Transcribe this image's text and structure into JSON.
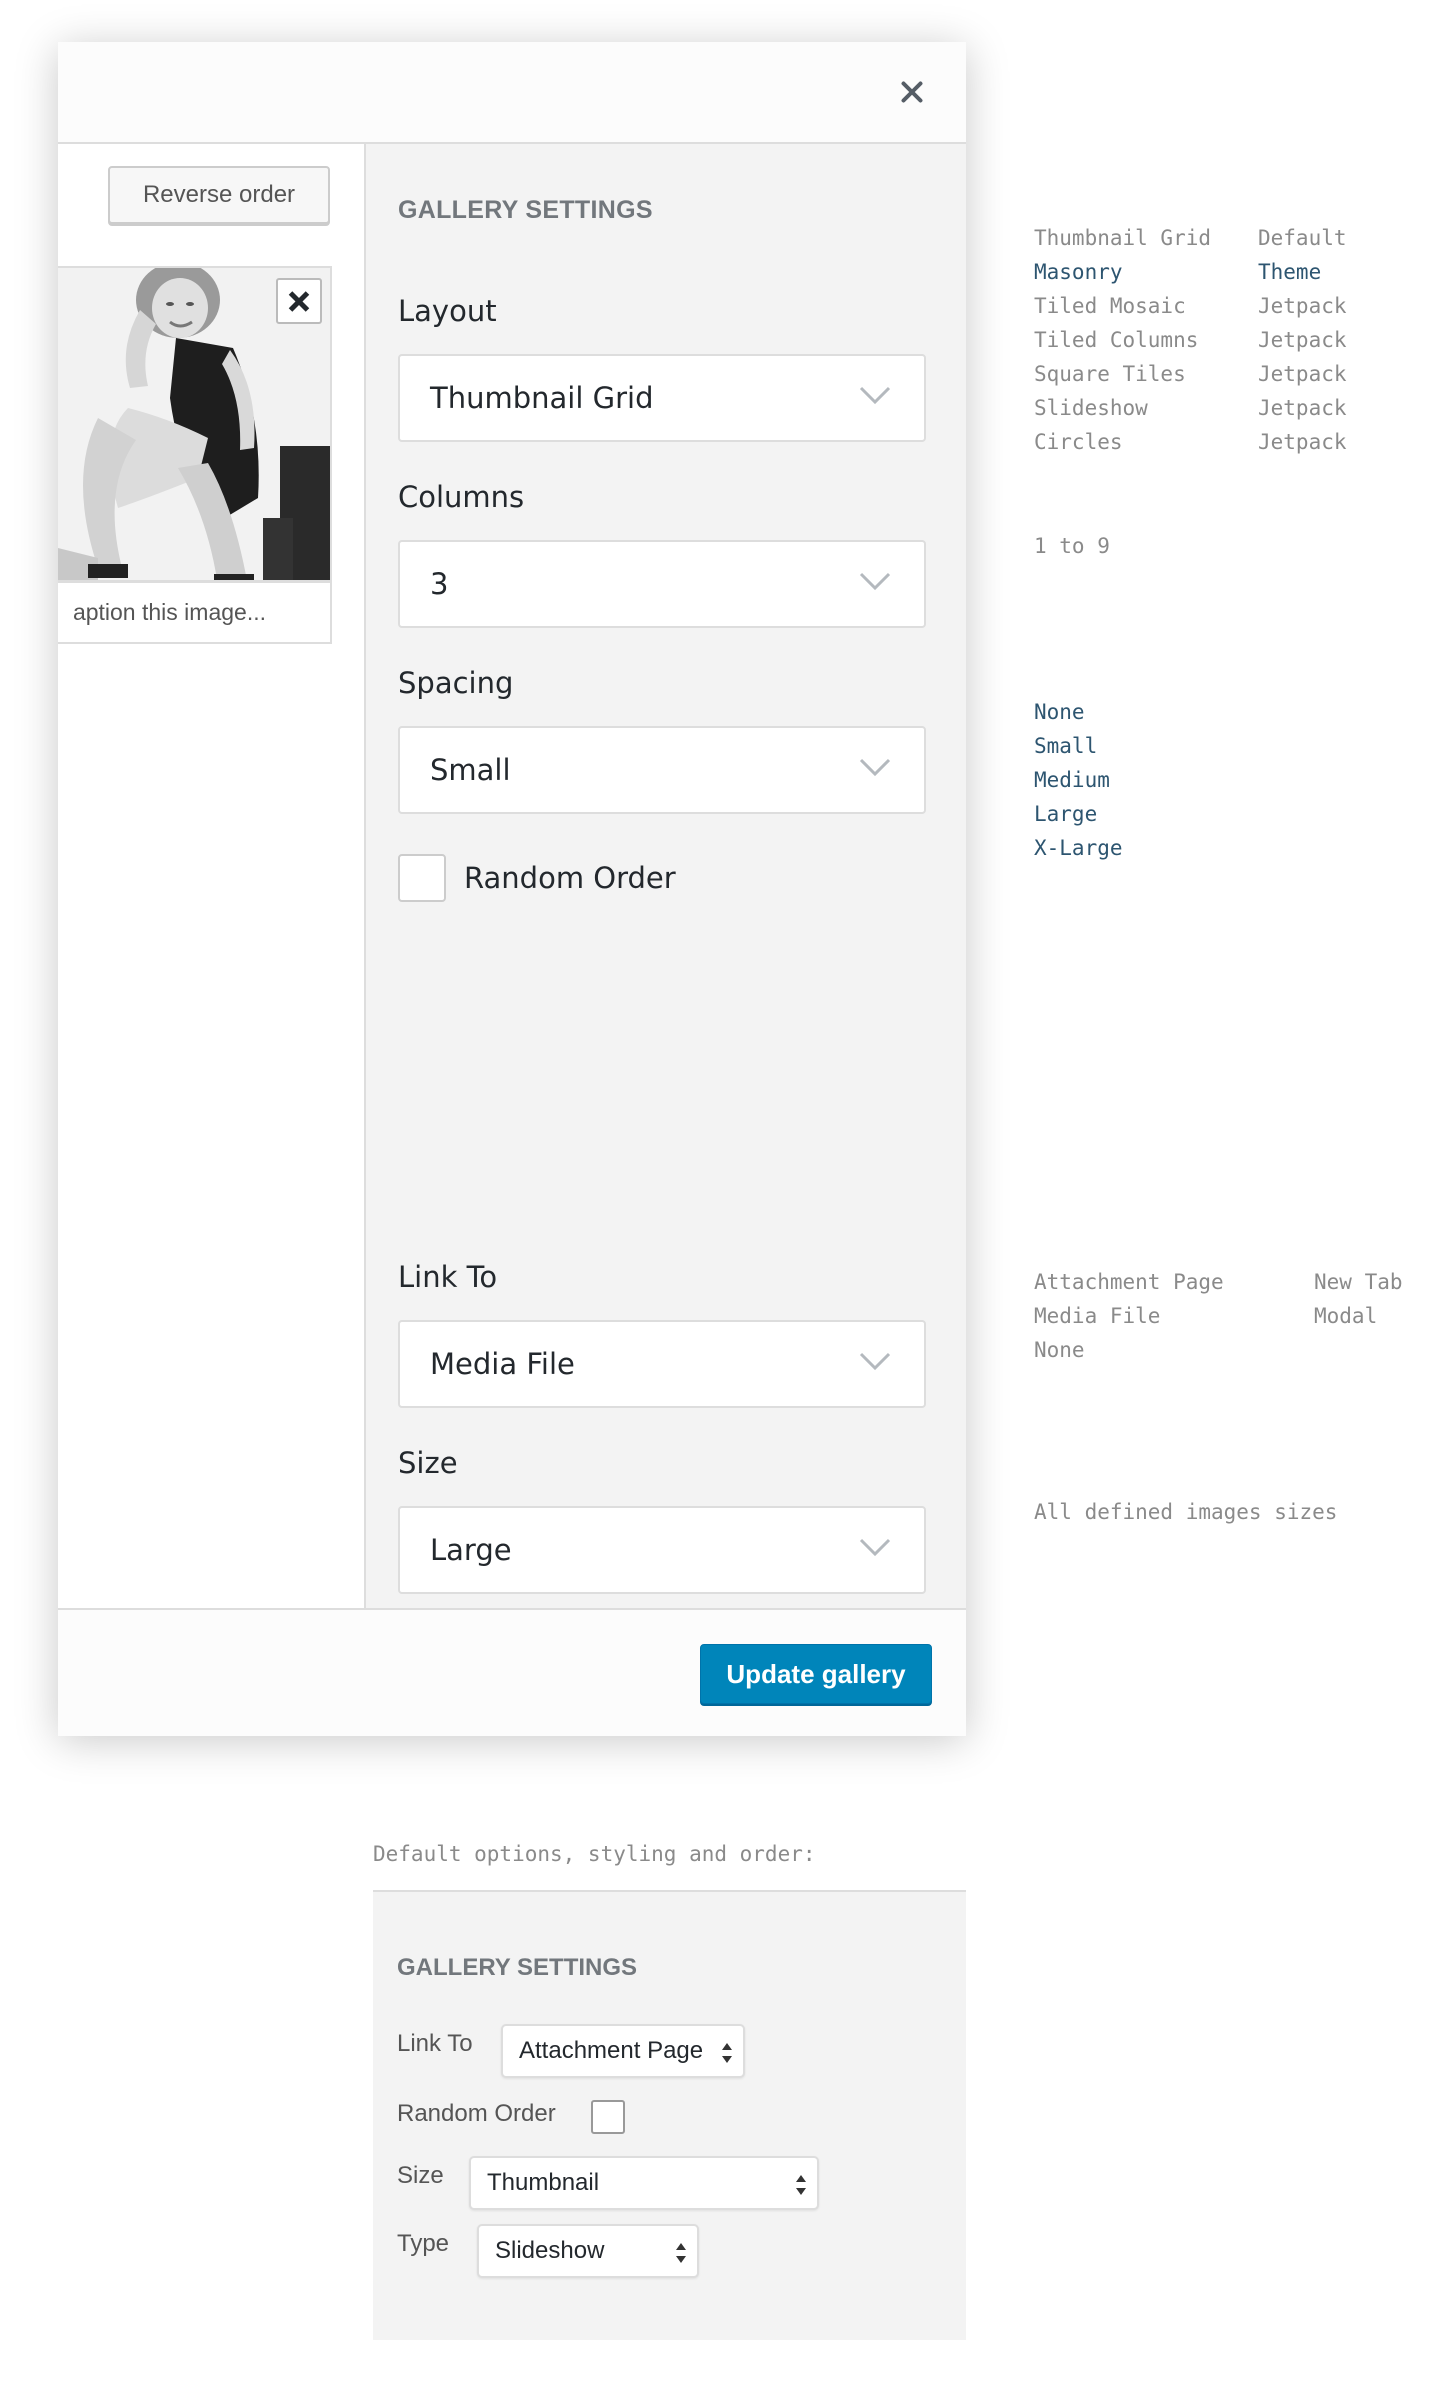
{
  "modal": {
    "close_label": "×",
    "reverse_order_label": "Reverse order",
    "image_caption_placeholder": "aption this image...",
    "settings_title": "GALLERY SETTINGS",
    "layout": {
      "label": "Layout",
      "value": "Thumbnail Grid"
    },
    "columns": {
      "label": "Columns",
      "value": "3"
    },
    "spacing": {
      "label": "Spacing",
      "value": "Small"
    },
    "random_order": {
      "label": "Random Order",
      "checked": false
    },
    "link_to": {
      "label": "Link To",
      "value": "Media File"
    },
    "size": {
      "label": "Size",
      "value": "Large"
    },
    "update_button": "Update gallery",
    "primary_color": "#0085ba"
  },
  "annotations": {
    "layout_options": [
      {
        "name": "Thumbnail Grid",
        "source": "Default",
        "highlight": false
      },
      {
        "name": "Masonry",
        "source": "Theme",
        "highlight": true
      },
      {
        "name": "Tiled Mosaic",
        "source": "Jetpack",
        "highlight": false
      },
      {
        "name": "Tiled Columns",
        "source": "Jetpack",
        "highlight": false
      },
      {
        "name": "Square Tiles",
        "source": "Jetpack",
        "highlight": false
      },
      {
        "name": "Slideshow",
        "source": "Jetpack",
        "highlight": false
      },
      {
        "name": "Circles",
        "source": "Jetpack",
        "highlight": false
      }
    ],
    "columns_range": "1 to 9",
    "spacing_options": [
      "None",
      "Small",
      "Medium",
      "Large",
      "X-Large"
    ],
    "link_options": [
      {
        "name": "Attachment Page",
        "extra": "New Tab"
      },
      {
        "name": "Media File",
        "extra": "Modal"
      },
      {
        "name": "None",
        "extra": ""
      }
    ],
    "size_note": "All defined images sizes",
    "highlight_color": "#2d5570"
  },
  "default_panel": {
    "heading": "Default options, styling and order:",
    "settings_title": "GALLERY SETTINGS",
    "link_to": {
      "label": "Link To",
      "value": "Attachment Page"
    },
    "random_order": {
      "label": "Random Order",
      "checked": false
    },
    "size": {
      "label": "Size",
      "value": "Thumbnail"
    },
    "type": {
      "label": "Type",
      "value": "Slideshow"
    }
  }
}
